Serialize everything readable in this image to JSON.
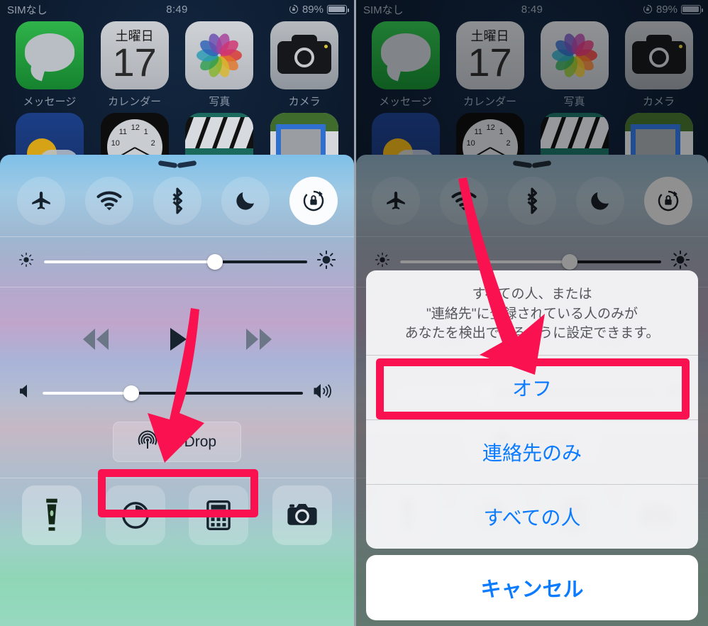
{
  "statusbar": {
    "carrier": "SIMなし",
    "time": "8:49",
    "rotation_lock_icon": "rotation-lock-icon",
    "battery_percent": "89%"
  },
  "homescreen": {
    "rows": [
      [
        {
          "label": "メッセージ",
          "icon": "messages-icon"
        },
        {
          "label": "カレンダー",
          "icon": "calendar-icon",
          "weekday": "土曜日",
          "day": "17"
        },
        {
          "label": "写真",
          "icon": "photos-icon"
        },
        {
          "label": "カメラ",
          "icon": "camera-icon"
        }
      ],
      [
        {
          "label": "",
          "icon": "weather-icon"
        },
        {
          "label": "",
          "icon": "clock-icon"
        },
        {
          "label": "",
          "icon": "videos-icon"
        },
        {
          "label": "",
          "icon": "maps-icon"
        }
      ]
    ],
    "clock_numbers": [
      "11",
      "12",
      "1",
      "2",
      "10"
    ]
  },
  "control_center": {
    "handle_icon": "chevron-handle-icon",
    "toggles": [
      {
        "name": "airplane-mode",
        "icon": "airplane-icon",
        "active": false
      },
      {
        "name": "wifi",
        "icon": "wifi-icon",
        "active": false
      },
      {
        "name": "bluetooth",
        "icon": "bluetooth-icon",
        "active": false
      },
      {
        "name": "do-not-disturb",
        "icon": "moon-icon",
        "active": false
      },
      {
        "name": "rotation-lock",
        "icon": "rotation-lock-icon",
        "active": true
      }
    ],
    "brightness": {
      "value": 65,
      "low_icon": "brightness-low-icon",
      "high_icon": "brightness-high-icon"
    },
    "media": {
      "rewind_icon": "rewind-icon",
      "play_icon": "play-icon",
      "forward_icon": "fast-forward-icon"
    },
    "volume": {
      "value": 34,
      "low_icon": "volume-mute-icon",
      "high_icon": "volume-high-icon"
    },
    "airdrop": {
      "label": "AirDrop",
      "icon": "airdrop-icon"
    },
    "shortcuts": [
      {
        "name": "flashlight",
        "icon": "flashlight-icon",
        "active": true
      },
      {
        "name": "timer",
        "icon": "timer-icon",
        "active": false
      },
      {
        "name": "calculator",
        "icon": "calculator-icon",
        "active": false
      },
      {
        "name": "camera",
        "icon": "camera-icon",
        "active": false
      }
    ]
  },
  "airdrop_sheet": {
    "message": "すべての人、または\n\"連絡先\"に登録されている人のみが\nあなたを検出できるように設定できます。",
    "message_lines": [
      "すべての人、または",
      "\"連絡先\"に登録されている人のみが",
      "あなたを検出できるように設定できます。"
    ],
    "options": [
      {
        "label": "オフ",
        "highlighted": true
      },
      {
        "label": "連絡先のみ",
        "highlighted": false
      },
      {
        "label": "すべての人",
        "highlighted": false
      }
    ],
    "cancel_label": "キャンセル"
  },
  "annotations": {
    "highlight_color": "#f9124f",
    "arrow_color": "#f9124f",
    "left_arrow_target": "AirDrop",
    "right_arrow_target": "オフ"
  }
}
